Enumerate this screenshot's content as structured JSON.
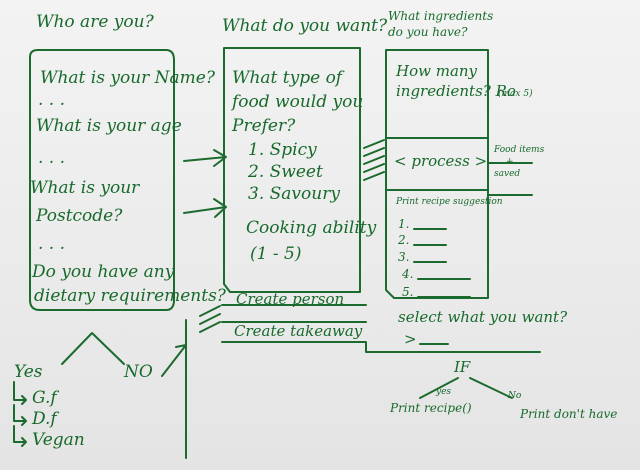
{
  "col1": {
    "heading": "Who are you?",
    "q_name": "What is your Name?",
    "dots1": ". . .",
    "q_age": "What is your age",
    "dots2": ". . .",
    "q_postcode_line1": "What is your",
    "q_postcode_line2": "Postcode?",
    "dots3": ". . .",
    "q_dietary_line1": "Do you have any",
    "q_dietary_line2": "dietary requirements?",
    "answer_yes": "Yes",
    "answer_no": "NO",
    "options": [
      "G.f",
      "D.f",
      "Vegan"
    ]
  },
  "col2": {
    "heading": "What do you want?",
    "q_food_line1": "What type of",
    "q_food_line2": "food would you",
    "q_food_line3": "Prefer?",
    "choices": [
      "1. Spicy",
      "2. Sweet",
      "3. Savoury"
    ],
    "cooking_line1": "Cooking ability",
    "cooking_line2": "(1 - 5)",
    "actions": [
      "Create person",
      "Create takeaway"
    ]
  },
  "col3": {
    "heading_line1": "What ingredients",
    "heading_line2": "do you have?",
    "q_count_line1": "How many",
    "q_count_line2": "ingredients? Ro",
    "max_note": "(max 5)",
    "process": "< process >",
    "food_items_line1": "Food items",
    "food_items_line2": "+",
    "food_items_line3": "saved",
    "print_suggestion": "Print recipe suggestion",
    "numbered": [
      "1.",
      "2.",
      "3.",
      "4.",
      "5."
    ],
    "select_prompt": "select what you want?",
    "select_cursor": ">",
    "if_label": "IF",
    "if_yes": "yes",
    "if_no": "No",
    "yes_action": "Print recipe()",
    "no_action": "Print don't have"
  }
}
